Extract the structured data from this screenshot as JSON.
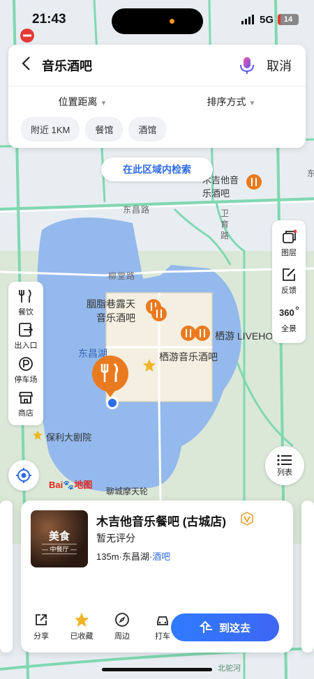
{
  "status": {
    "time": "21:43",
    "network": "5G",
    "battery": "14"
  },
  "search": {
    "back_icon": "chevron-left-icon",
    "query": "音乐酒吧",
    "cancel": "取消"
  },
  "filters": {
    "distance": "位置距离",
    "sort": "排序方式"
  },
  "chips": [
    "附近 1KM",
    "餐馆",
    "酒馆"
  ],
  "search_area_button": "在此区域内检索",
  "left_tools": [
    {
      "icon": "fork-knife-icon",
      "label": "餐饮"
    },
    {
      "icon": "exit-icon",
      "label": "出入口"
    },
    {
      "icon": "parking-icon",
      "label": "停车场"
    },
    {
      "icon": "shop-icon",
      "label": "商店"
    }
  ],
  "right_tools": [
    {
      "icon": "layers-icon",
      "label": "图层"
    },
    {
      "icon": "edit-icon",
      "label": "反馈"
    },
    {
      "icon": "panorama-360-icon",
      "label": "全景"
    }
  ],
  "list_button": "列表",
  "map": {
    "logo_text": "Bai",
    "logo_suffix": "地图",
    "labels": {
      "poi_top": "木吉他音",
      "poi_top2": "乐酒吧",
      "poi_rouge": "胭脂巷露天",
      "poi_rouge2": "音乐酒吧",
      "poi_qiyou_live": "栖游 LIVEHO",
      "poi_qiyou": "栖游音乐酒吧",
      "lake": "东昌湖",
      "theatre": "保利大剧院",
      "ferris": "聊城摩天轮",
      "road_dongchang": "东昌路",
      "road_liutang": "柳堂路",
      "road_weiyu": "卫育路",
      "road_east": "东",
      "road_bottom": "北驼河"
    }
  },
  "card": {
    "name": "木吉他音乐餐吧 (古城店)",
    "rating": "暂无评分",
    "distance": "135m",
    "area": "东昌湖",
    "category": "酒吧",
    "thumb_tag": "美食",
    "thumb_sub": "— 中餐厅 —"
  },
  "actions": [
    {
      "icon": "share-icon",
      "label": "分享"
    },
    {
      "icon": "star-filled-icon",
      "label": "已收藏"
    },
    {
      "icon": "compass-icon",
      "label": "周边"
    },
    {
      "icon": "car-icon",
      "label": "打车"
    }
  ],
  "goto_button": "到这去",
  "colors": {
    "accent": "#2e6be6",
    "poi_orange": "#ea7a1f",
    "water": "#93b8eb",
    "park": "#cfe3c6"
  }
}
